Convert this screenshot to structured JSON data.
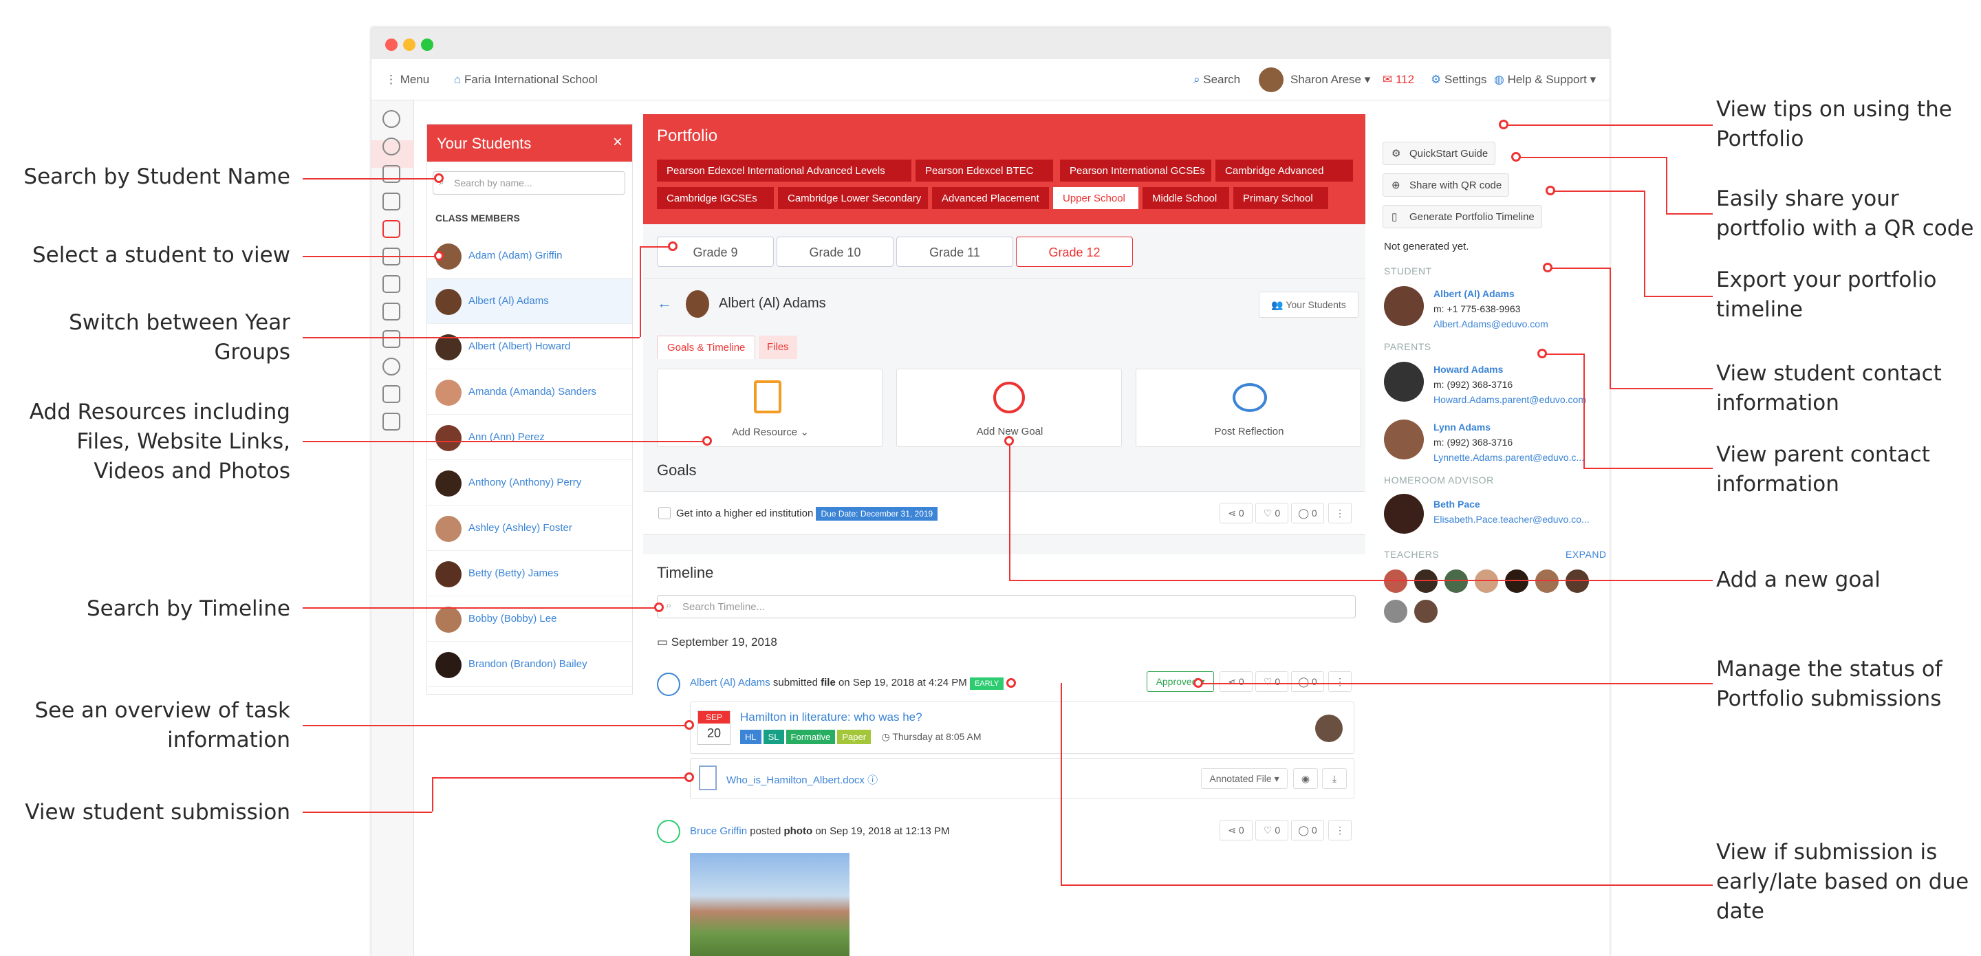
{
  "annotations_left": [
    {
      "text": "Search by Student Name"
    },
    {
      "text": "Select a student to view"
    },
    {
      "text": "Switch between Year Groups"
    },
    {
      "text": "Add Resources including Files, Website Links, Videos and Photos"
    },
    {
      "text": "Search by Timeline"
    },
    {
      "text": "See an overview of task information"
    },
    {
      "text": "View student submission"
    }
  ],
  "annotations_right": [
    {
      "text": "View tips on using the Portfolio"
    },
    {
      "text": "Easily share your portfolio with a QR code"
    },
    {
      "text": "Export your portfolio timeline"
    },
    {
      "text": "View student contact information"
    },
    {
      "text": "View parent contact information"
    },
    {
      "text": "Add a new goal"
    },
    {
      "text": "Manage the status of Portfolio submissions"
    },
    {
      "text": "View if submission is early/late based on due date"
    }
  ],
  "topnav": {
    "menu": "Menu",
    "school": "Faria International School",
    "search": "Search",
    "user": "Sharon Arese",
    "mail_count": "112",
    "settings": "Settings",
    "help": "Help & Support"
  },
  "students": {
    "title": "Your Students",
    "search_placeholder": "Search by name...",
    "section": "CLASS MEMBERS",
    "list": [
      "Adam (Adam) Griffin",
      "Albert (Al) Adams",
      "Albert (Albert) Howard",
      "Amanda (Amanda) Sanders",
      "Ann (Ann) Perez",
      "Anthony (Anthony) Perry",
      "Ashley (Ashley) Foster",
      "Betty (Betty) James",
      "Bobby (Bobby) Lee",
      "Brandon (Brandon) Bailey"
    ]
  },
  "portfolio": {
    "title": "Portfolio",
    "programmes": [
      "Pearson Edexcel International Advanced Levels",
      "Pearson Edexcel BTEC",
      "Pearson International GCSEs",
      "Cambridge Advanced",
      "Cambridge IGCSEs",
      "Cambridge Lower Secondary",
      "Advanced Placement",
      "Upper School",
      "Middle School",
      "Primary School"
    ],
    "grades": [
      "Grade 9",
      "Grade 10",
      "Grade 11",
      "Grade 12"
    ],
    "student_name": "Albert (Al) Adams",
    "your_students_btn": "Your Students",
    "tabs": [
      "Goals & Timeline",
      "Files"
    ],
    "actions": [
      "Add Resource",
      "Add New Goal",
      "Post Reflection"
    ],
    "goals_title": "Goals",
    "goal_text": "Get into a higher ed institution",
    "goal_due": "Due Date: December 31, 2019",
    "counts": [
      "0",
      "0",
      "0"
    ],
    "timeline_title": "Timeline",
    "timeline_placeholder": "Search Timeline...",
    "date": "September 19, 2018",
    "entry1": {
      "who": "Albert (Al) Adams",
      "verb": "submitted",
      "what": "file",
      "when": "on Sep 19, 2018 at 4:24 PM",
      "badge": "EARLY",
      "status": "Approved"
    },
    "task": {
      "month": "SEP",
      "day": "20",
      "title": "Hamilton in literature: who was he?",
      "tags": [
        "HL",
        "SL",
        "Formative",
        "Paper"
      ],
      "due": "Thursday at 8:05 AM"
    },
    "file": {
      "name": "Who_is_Hamilton_Albert.docx",
      "btn": "Annotated File"
    },
    "entry2": {
      "who": "Bruce Griffin",
      "verb": "posted",
      "what": "photo",
      "when": "on Sep 19, 2018 at 12:13 PM"
    }
  },
  "sidebar": {
    "quickstart": "QuickStart Guide",
    "share": "Share with QR code",
    "generate": "Generate Portfolio Timeline",
    "not_generated": "Not generated yet.",
    "student_lbl": "STUDENT",
    "student": {
      "name": "Albert (Al) Adams",
      "phone": "m: +1 775-638-9963",
      "email": "Albert.Adams@eduvo.com"
    },
    "parents_lbl": "PARENTS",
    "parents": [
      {
        "name": "Howard Adams",
        "phone": "m: (992) 368-3716",
        "email": "Howard.Adams.parent@eduvo.com"
      },
      {
        "name": "Lynn Adams",
        "phone": "m: (992) 368-3716",
        "email": "Lynnette.Adams.parent@eduvo.c..."
      }
    ],
    "advisor_lbl": "HOMEROOM ADVISOR",
    "advisor": {
      "name": "Beth Pace",
      "email": "Elisabeth.Pace.teacher@eduvo.co..."
    },
    "teachers_lbl": "TEACHERS",
    "expand": "EXPAND"
  }
}
